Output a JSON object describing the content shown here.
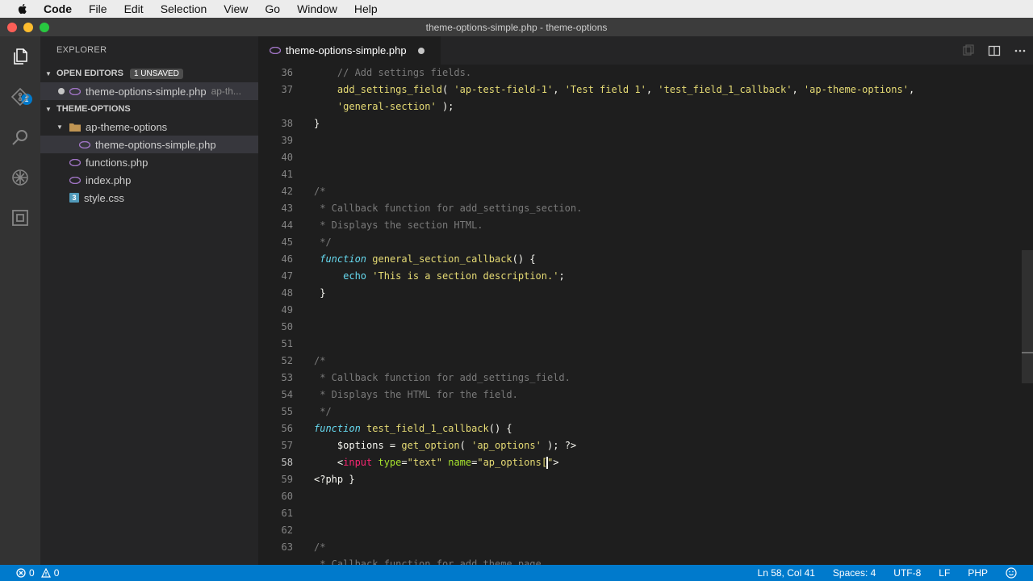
{
  "menubar": {
    "app": "Code",
    "items": [
      "File",
      "Edit",
      "Selection",
      "View",
      "Go",
      "Window",
      "Help"
    ]
  },
  "window": {
    "title": "theme-options-simple.php - theme-options"
  },
  "activitybar": {
    "explorer_badge": "1"
  },
  "sidebar": {
    "title": "EXPLORER",
    "open_editors": {
      "label": "OPEN EDITORS",
      "badge": "1 UNSAVED",
      "items": [
        {
          "name": "theme-options-simple.php",
          "description": "ap-th..."
        }
      ]
    },
    "project": {
      "label": "THEME-OPTIONS",
      "folder": "ap-theme-options",
      "folder_files": [
        "theme-options-simple.php"
      ],
      "files": [
        "functions.php",
        "index.php",
        "style.css"
      ]
    }
  },
  "editor": {
    "active_tab": "theme-options-simple.php",
    "lines": [
      {
        "n": "36",
        "tokens": [
          [
            "c-comment",
            "    // Add settings fields."
          ]
        ]
      },
      {
        "n": "37",
        "tokens": [
          [
            "c-fn",
            "    add_settings_field"
          ],
          [
            "c-plain",
            "( "
          ],
          [
            "c-str",
            "'ap-test-field-1'"
          ],
          [
            "c-plain",
            ", "
          ],
          [
            "c-str",
            "'Test field 1'"
          ],
          [
            "c-plain",
            ", "
          ],
          [
            "c-str",
            "'test_field_1_callback'"
          ],
          [
            "c-plain",
            ", "
          ],
          [
            "c-str",
            "'ap-theme-options'"
          ],
          [
            "c-plain",
            ","
          ]
        ]
      },
      {
        "n": "",
        "tokens": [
          [
            "c-str",
            "    'general-section'"
          ],
          [
            "c-plain",
            " );"
          ]
        ]
      },
      {
        "n": "38",
        "tokens": [
          [
            "c-plain",
            "}"
          ]
        ]
      },
      {
        "n": "39",
        "tokens": []
      },
      {
        "n": "40",
        "tokens": []
      },
      {
        "n": "41",
        "tokens": []
      },
      {
        "n": "42",
        "tokens": [
          [
            "c-comment",
            "/*"
          ]
        ]
      },
      {
        "n": "43",
        "tokens": [
          [
            "c-comment",
            " * Callback function for add_settings_section."
          ]
        ]
      },
      {
        "n": "44",
        "tokens": [
          [
            "c-comment",
            " * Displays the section HTML."
          ]
        ]
      },
      {
        "n": "45",
        "tokens": [
          [
            "c-comment",
            " */"
          ]
        ]
      },
      {
        "n": "46",
        "tokens": [
          [
            "c-kw",
            " function"
          ],
          [
            "c-plain",
            " "
          ],
          [
            "c-fn",
            "general_section_callback"
          ],
          [
            "c-plain",
            "() {"
          ]
        ]
      },
      {
        "n": "47",
        "tokens": [
          [
            "c-echo",
            "     echo"
          ],
          [
            "c-plain",
            " "
          ],
          [
            "c-str",
            "'This is a section description.'"
          ],
          [
            "c-plain",
            ";"
          ]
        ]
      },
      {
        "n": "48",
        "tokens": [
          [
            "c-plain",
            " }"
          ]
        ]
      },
      {
        "n": "49",
        "tokens": []
      },
      {
        "n": "50",
        "tokens": []
      },
      {
        "n": "51",
        "tokens": []
      },
      {
        "n": "52",
        "tokens": [
          [
            "c-comment",
            "/*"
          ]
        ]
      },
      {
        "n": "53",
        "tokens": [
          [
            "c-comment",
            " * Callback function for add_settings_field."
          ]
        ]
      },
      {
        "n": "54",
        "tokens": [
          [
            "c-comment",
            " * Displays the HTML for the field."
          ]
        ]
      },
      {
        "n": "55",
        "tokens": [
          [
            "c-comment",
            " */"
          ]
        ]
      },
      {
        "n": "56",
        "tokens": [
          [
            "c-kw",
            "function"
          ],
          [
            "c-plain",
            " "
          ],
          [
            "c-fn",
            "test_field_1_callback"
          ],
          [
            "c-plain",
            "() {"
          ]
        ]
      },
      {
        "n": "57",
        "tokens": [
          [
            "c-var",
            "    $options"
          ],
          [
            "c-plain",
            " = "
          ],
          [
            "c-fn",
            "get_option"
          ],
          [
            "c-plain",
            "( "
          ],
          [
            "c-str",
            "'ap_options'"
          ],
          [
            "c-plain",
            " ); ?>"
          ]
        ]
      },
      {
        "n": "58",
        "tokens": [
          [
            "c-plain",
            "    <"
          ],
          [
            "c-tag",
            "input"
          ],
          [
            "c-plain",
            " "
          ],
          [
            "c-attr",
            "type"
          ],
          [
            "c-plain",
            "="
          ],
          [
            "c-str",
            "\"text\""
          ],
          [
            "c-plain",
            " "
          ],
          [
            "c-attr",
            "name"
          ],
          [
            "c-plain",
            "="
          ],
          [
            "c-str",
            "\"ap_options["
          ],
          [
            "cursor",
            ""
          ],
          [
            "c-str",
            "\""
          ],
          [
            "c-plain",
            ">"
          ]
        ]
      },
      {
        "n": "59",
        "tokens": [
          [
            "c-plain",
            "<?php }"
          ]
        ]
      },
      {
        "n": "60",
        "tokens": []
      },
      {
        "n": "61",
        "tokens": []
      },
      {
        "n": "62",
        "tokens": []
      },
      {
        "n": "63",
        "tokens": [
          [
            "c-comment",
            "/*"
          ]
        ]
      },
      {
        "n": "",
        "tokens": [
          [
            "c-comment",
            " * Callback function for add_theme_page."
          ]
        ]
      }
    ]
  },
  "statusbar": {
    "errors": "0",
    "warnings": "0",
    "position": "Ln 58, Col 41",
    "spaces": "Spaces: 4",
    "encoding": "UTF-8",
    "eol": "LF",
    "language": "PHP"
  }
}
